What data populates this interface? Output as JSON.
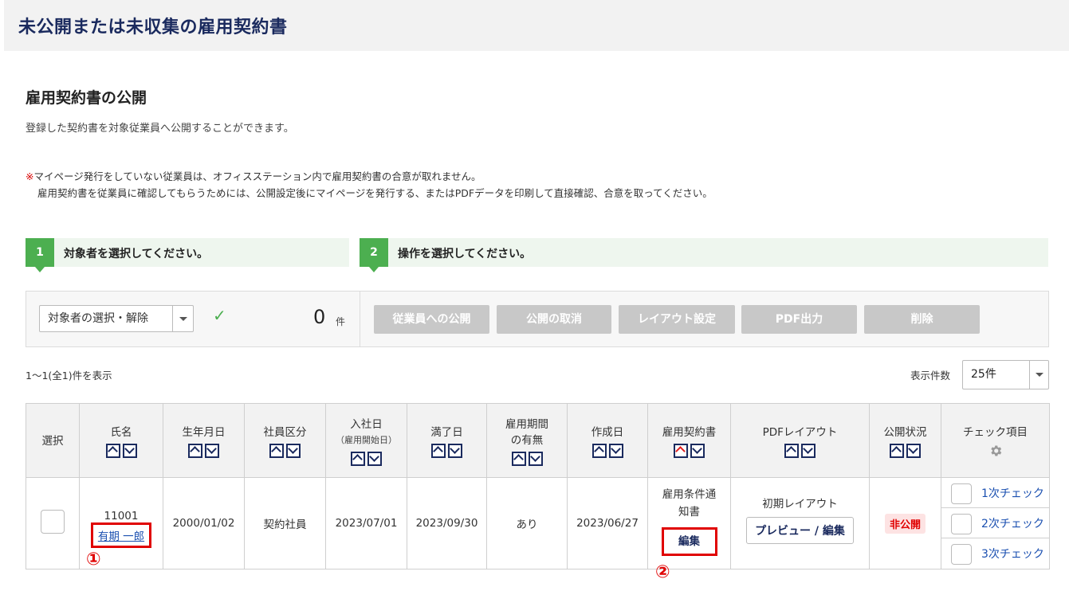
{
  "page": {
    "title": "未公開または未収集の雇用契約書"
  },
  "section": {
    "title": "雇用契約書の公開",
    "description": "登録した契約書を対象従業員へ公開することができます。"
  },
  "notice": {
    "mark": "※",
    "line1": "マイページ発行をしていない従業員は、オフィスステーション内で雇用契約書の合意が取れません。",
    "line2": "雇用契約書を従業員に確認してもらうためには、公開設定後にマイページを発行する、またはPDFデータを印刷して直接確認、合意を取ってください。"
  },
  "steps": [
    {
      "num": "1",
      "label": "対象者を選択してください。"
    },
    {
      "num": "2",
      "label": "操作を選択してください。"
    }
  ],
  "toolbar": {
    "select_label": "対象者の選択・解除",
    "count": "0",
    "count_unit": "件",
    "actions": [
      "従業員への公開",
      "公開の取消",
      "レイアウト設定",
      "PDF出力",
      "削除"
    ]
  },
  "pagination": {
    "range_text": "1〜1(全1)件を表示",
    "per_page_label": "表示件数",
    "per_page_value": "25件"
  },
  "table": {
    "headers": {
      "select": "選択",
      "name": "氏名",
      "birth": "生年月日",
      "type": "社員区分",
      "join": "入社日",
      "join_sub": "（雇用開始日）",
      "end": "満了日",
      "period_1": "雇用期間",
      "period_2": "の有無",
      "created": "作成日",
      "contract": "雇用契約書",
      "pdf": "PDFレイアウト",
      "status": "公開状況",
      "check": "チェック項目"
    },
    "row": {
      "code": "11001",
      "name": "有期 一郎",
      "birth": "2000/01/02",
      "type": "契約社員",
      "join": "2023/07/01",
      "end": "2023/09/30",
      "period": "あり",
      "created": "2023/06/27",
      "doc_line1": "雇用条件通",
      "doc_line2": "知書",
      "edit": "編集",
      "layout": "初期レイアウト",
      "preview": "プレビュー / 編集",
      "status": "非公開",
      "checks": [
        "1次チェック",
        "2次チェック",
        "3次チェック"
      ]
    }
  },
  "annotations": {
    "one": "①",
    "two": "②"
  },
  "colors": {
    "accent": "#4caf50",
    "navy": "#1a2a5e",
    "highlight": "#e00000"
  }
}
